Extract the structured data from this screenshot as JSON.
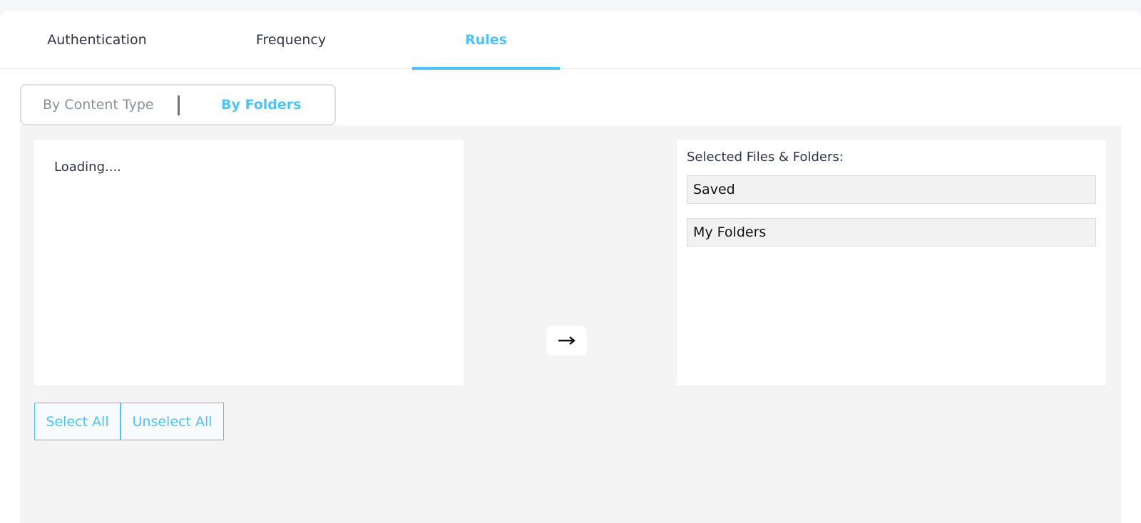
{
  "tabs": [
    {
      "label": "Authentication",
      "active": false
    },
    {
      "label": "Frequency",
      "active": false
    },
    {
      "label": "Rules",
      "active": true
    }
  ],
  "rule_mode": {
    "options": [
      "By Content Type",
      "By Folders"
    ],
    "selected": "By Folders"
  },
  "source_panel": {
    "status_text": "Loading...."
  },
  "transfer_button": {
    "icon": "arrow-right-icon"
  },
  "selected_panel": {
    "title": "Selected Files & Folders:",
    "items": [
      "Saved",
      "My Folders"
    ]
  },
  "actions": {
    "select_all": "Select All",
    "unselect_all": "Unselect All"
  },
  "colors": {
    "accent": "#4fc3f7",
    "text": "#2f3347",
    "muted": "#8a8f9c",
    "workspace_bg": "#f4f4f4"
  }
}
